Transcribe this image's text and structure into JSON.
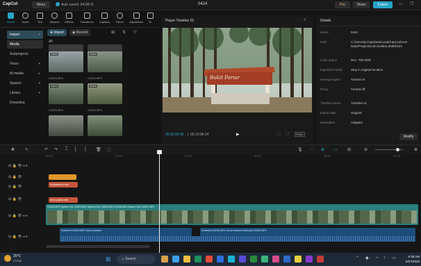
{
  "titlebar": {
    "app_name": "CapCut",
    "menu_label": "Menu",
    "autosave_status": "Auto saved: 04:38:11",
    "project_title": "0424",
    "pro_label": "Pro",
    "share_label": "Share",
    "export_label": "Export"
  },
  "toolbar": {
    "tools": [
      {
        "label": "Media",
        "icon": "media-icon"
      },
      {
        "label": "Audio",
        "icon": "audio-icon"
      },
      {
        "label": "Text",
        "icon": "text-icon"
      },
      {
        "label": "Stickers",
        "icon": "sticker-icon"
      },
      {
        "label": "Effects",
        "icon": "effects-icon"
      },
      {
        "label": "Transitions",
        "icon": "transitions-icon"
      },
      {
        "label": "Captions",
        "icon": "captions-icon"
      },
      {
        "label": "Filters",
        "icon": "filters-icon"
      },
      {
        "label": "Adjustment",
        "icon": "adjustment-icon"
      },
      {
        "label": "Te",
        "icon": "template-icon"
      }
    ]
  },
  "left_nav": {
    "items": [
      {
        "label": "Import",
        "selected": false
      },
      {
        "label": "Media",
        "selected": true
      },
      {
        "label": "Subprojects",
        "selected": false
      },
      {
        "label": "Yours",
        "selected": false
      },
      {
        "label": "AI media",
        "selected": false
      },
      {
        "label": "Spaces",
        "selected": false
      },
      {
        "label": "Library",
        "selected": false
      },
      {
        "label": "Dreamina",
        "selected": false
      }
    ]
  },
  "media": {
    "import_label": "Import",
    "record_label": "Record",
    "filter_all": "All",
    "thumbs": [
      {
        "name": "C0003.MP4",
        "badge": "Added"
      },
      {
        "name": "C0004.MP4",
        "badge": "Added"
      },
      {
        "name": "C0005.MP4",
        "badge": "Added"
      },
      {
        "name": "C0006.MP4",
        "badge": "Added"
      }
    ]
  },
  "player": {
    "title": "Player Timeline 01",
    "sign_text": "Bukit Pariar",
    "current_time": "00:09:06:00",
    "total_time": "00:10:09:14",
    "ratio_label": "Ratio"
  },
  "details": {
    "tab_label": "Details",
    "rows": [
      {
        "key": "Name",
        "value": "0424"
      },
      {
        "key": "Path",
        "value": "C:/Users/pc/AppData/Local/CapCut/User Data/Projects/com.lveditor.draft/0424"
      },
      {
        "key": "Color space",
        "value": "Rec. 709 SDR"
      },
      {
        "key": "Imported media",
        "value": "Stay in original location"
      },
      {
        "key": "Arrange layers",
        "value": "Turned on"
      },
      {
        "key": "Proxy",
        "value": "Turned off"
      },
      {
        "key": "Timeline frame",
        "value": "Timeline 01"
      },
      {
        "key": "Import ratio",
        "value": "Original"
      },
      {
        "key": "Resolution",
        "value": "Adapted"
      }
    ],
    "modify_label": "Modify"
  },
  "timeline": {
    "ruler": [
      "00:00",
      "10:00",
      "20:00",
      "30:00",
      "40:00",
      "50:00"
    ],
    "clips": {
      "orange_small": "",
      "red_1": "Scriptbase to text",
      "red_2": "Auto-caption text",
      "video_main": "C0003.MP4  Speed 0.5X  C0004.MP4  Speed 0.5X  C0005.MP4  C0006.MP4  Speed 0.5X  C0007.MP4",
      "audio_1": "Extracted C0004.MP4  Vocal enhance",
      "audio_2": "Extracted C0005.MP4  Vocal enhance  Extracted C0006.MP4"
    }
  },
  "taskbar": {
    "weather_temp": "25°C",
    "weather_desc": "Cerah",
    "search_placeholder": "Search",
    "time": "6:38 AM",
    "date": "6/27/2025"
  },
  "colors": {
    "accent": "#26a4c8",
    "orange_clip": "#e0972a",
    "red_clip": "#c4553b",
    "video_track": "#2a7f7f",
    "audio_track": "#1c4d7a"
  }
}
